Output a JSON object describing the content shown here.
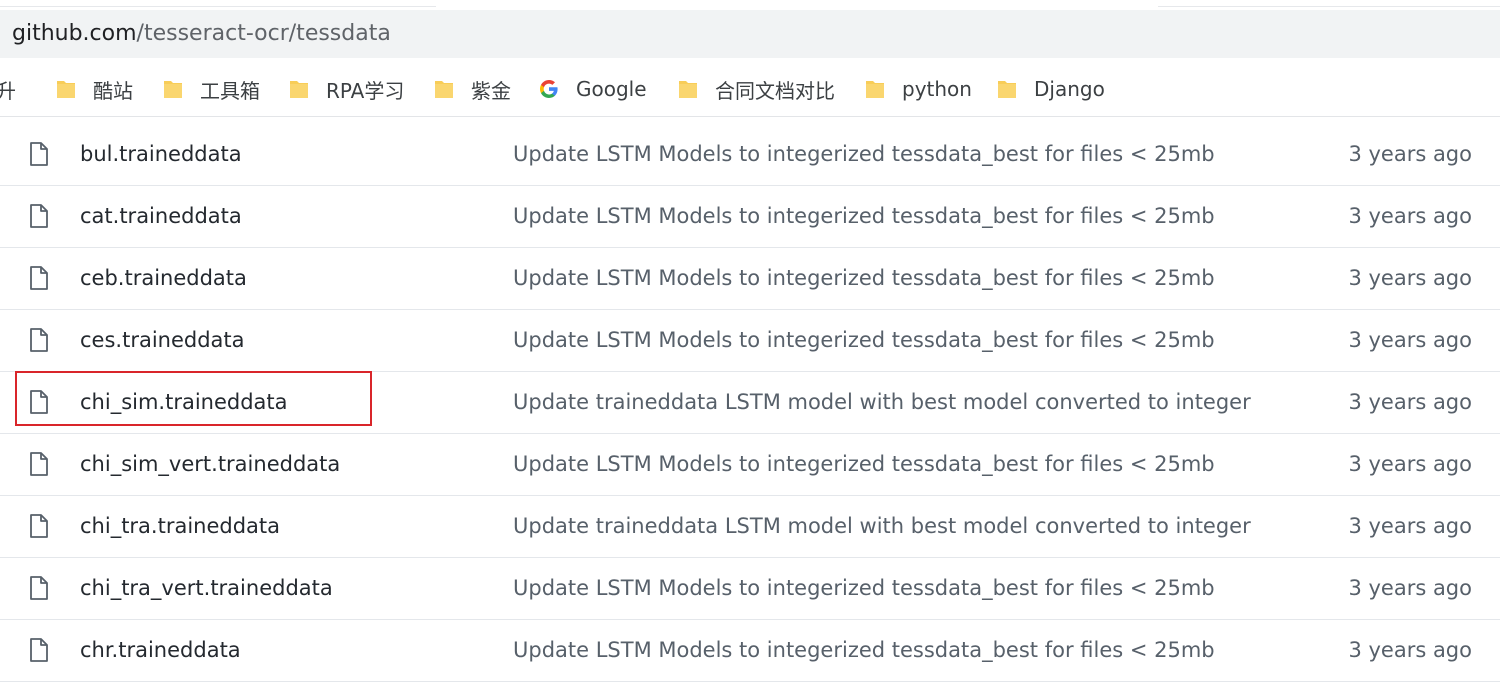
{
  "browser": {
    "url_host": "github.com",
    "url_path": "/tesseract-ocr/tessdata"
  },
  "bookmarks": [
    {
      "label": "升",
      "icon": "folder-icon",
      "cut": true
    },
    {
      "label": "酷站",
      "icon": "folder-icon"
    },
    {
      "label": "工具箱",
      "icon": "folder-icon"
    },
    {
      "label": "RPA学习",
      "icon": "folder-icon"
    },
    {
      "label": "紫金",
      "icon": "folder-icon"
    },
    {
      "label": "Google",
      "icon": "google-icon"
    },
    {
      "label": "合同文档对比",
      "icon": "folder-icon"
    },
    {
      "label": "python",
      "icon": "folder-icon"
    },
    {
      "label": "Django",
      "icon": "folder-icon"
    }
  ],
  "files": [
    {
      "name": "bul.traineddata",
      "commit": "Update LSTM Models to integerized tessdata_best for files < 25mb",
      "age": "3 years ago"
    },
    {
      "name": "cat.traineddata",
      "commit": "Update LSTM Models to integerized tessdata_best for files < 25mb",
      "age": "3 years ago"
    },
    {
      "name": "ceb.traineddata",
      "commit": "Update LSTM Models to integerized tessdata_best for files < 25mb",
      "age": "3 years ago"
    },
    {
      "name": "ces.traineddata",
      "commit": "Update LSTM Models to integerized tessdata_best for files < 25mb",
      "age": "3 years ago"
    },
    {
      "name": "chi_sim.traineddata",
      "commit": "Update traineddata LSTM model with best model converted to integer",
      "age": "3 years ago",
      "highlighted": true
    },
    {
      "name": "chi_sim_vert.traineddata",
      "commit": "Update LSTM Models to integerized tessdata_best for files < 25mb",
      "age": "3 years ago"
    },
    {
      "name": "chi_tra.traineddata",
      "commit": "Update traineddata LSTM model with best model converted to integer",
      "age": "3 years ago"
    },
    {
      "name": "chi_tra_vert.traineddata",
      "commit": "Update LSTM Models to integerized tessdata_best for files < 25mb",
      "age": "3 years ago"
    },
    {
      "name": "chr.traineddata",
      "commit": "Update LSTM Models to integerized tessdata_best for files < 25mb",
      "age": "3 years ago"
    }
  ],
  "colors": {
    "folder": "#f8cd58",
    "highlight_border": "#d9252a"
  }
}
